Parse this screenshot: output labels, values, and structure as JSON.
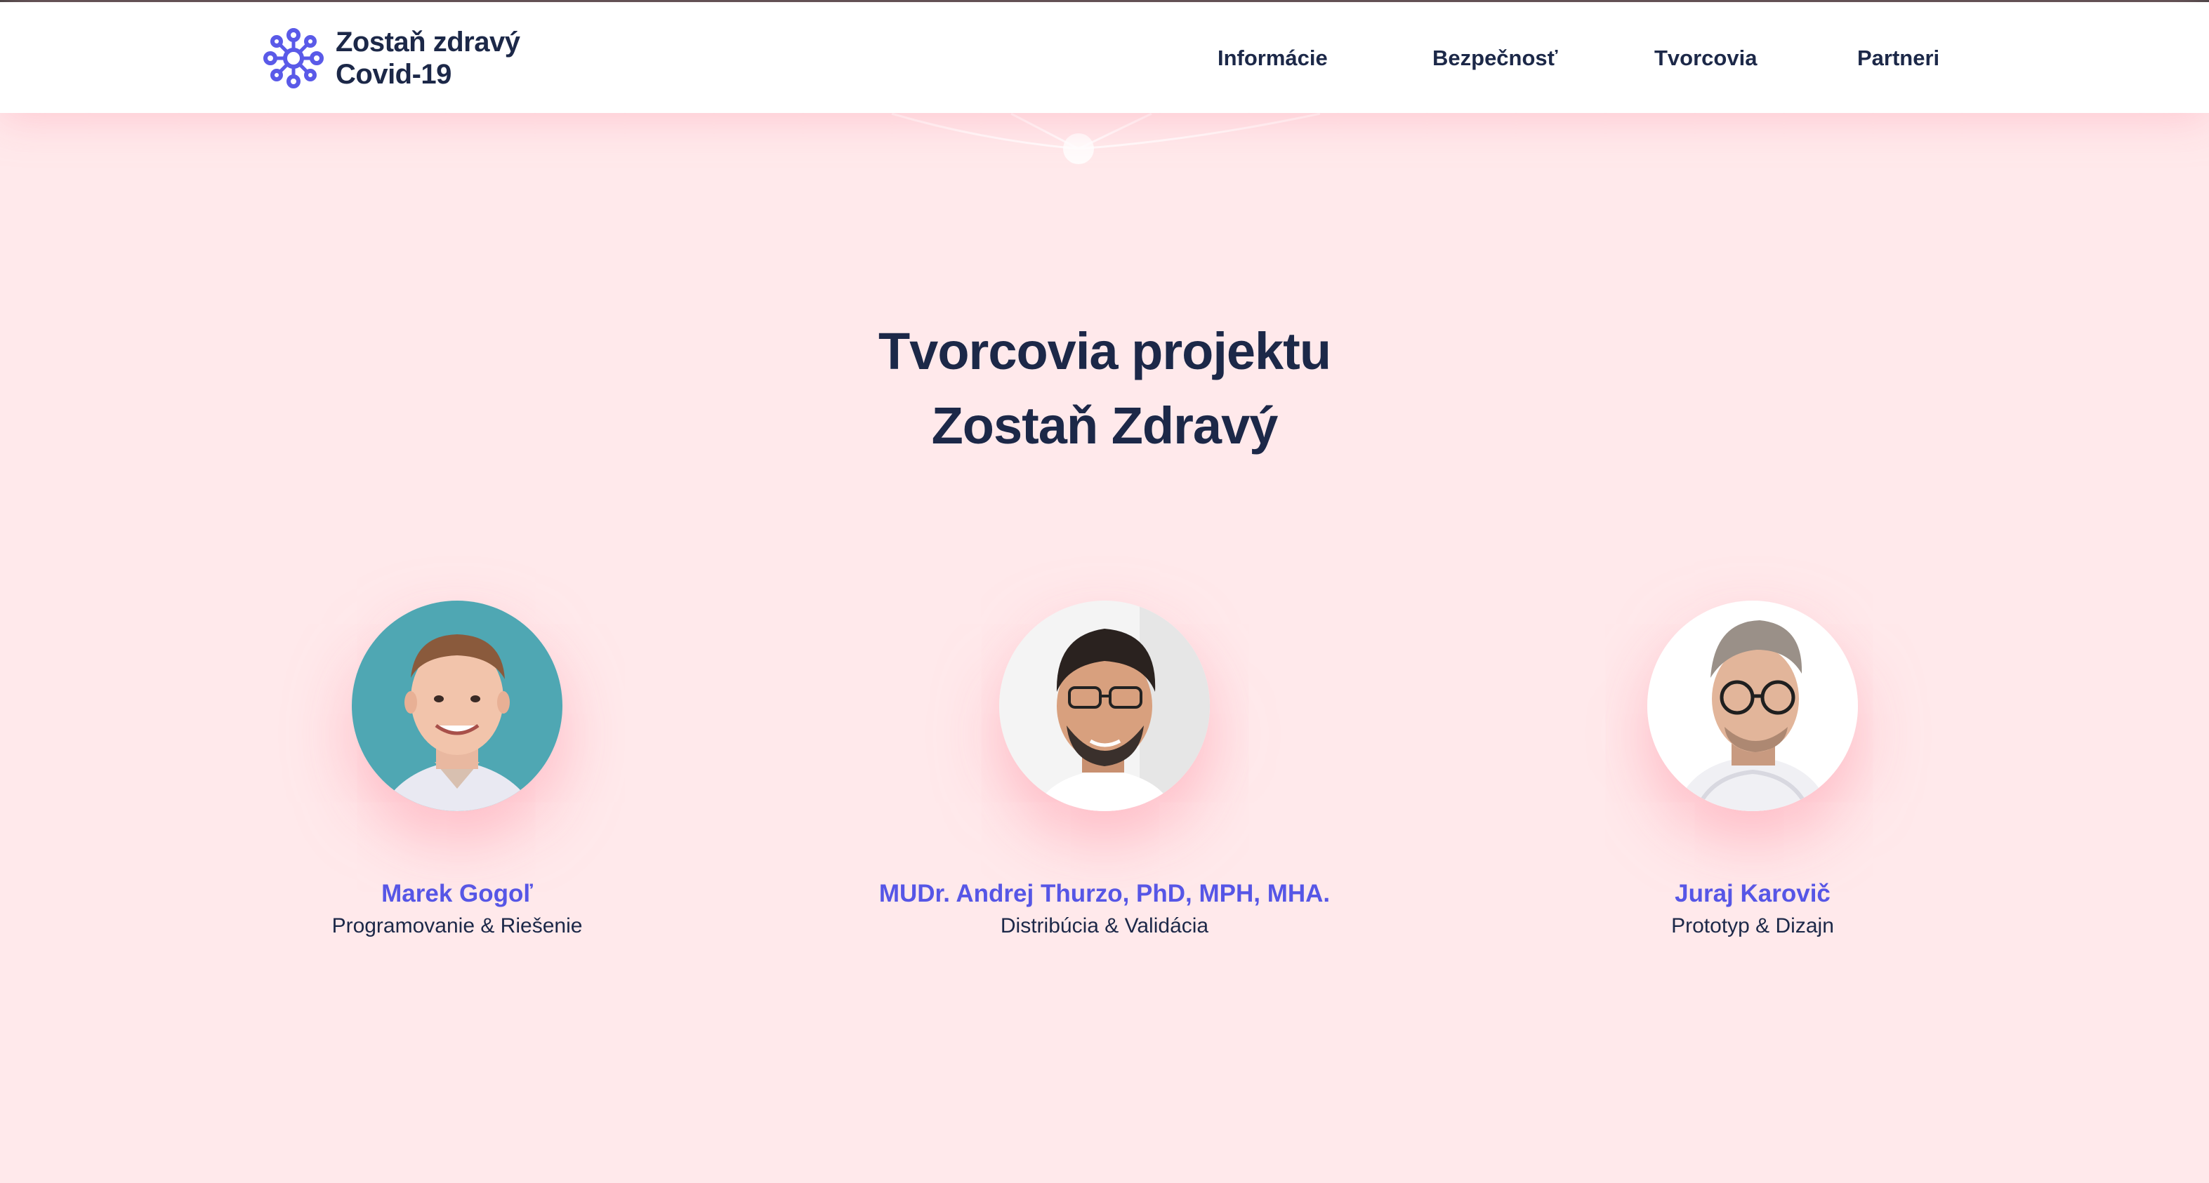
{
  "header": {
    "logo_line1": "Zostaň zdravý",
    "logo_line2": "Covid-19",
    "nav": [
      {
        "label": "Informácie"
      },
      {
        "label": "Bezpečnosť"
      },
      {
        "label": "Tvorcovia"
      },
      {
        "label": "Partneri"
      }
    ]
  },
  "section": {
    "title_line1": "Tvorcovia projektu",
    "title_line2": "Zostaň Zdravý"
  },
  "team": [
    {
      "name": "Marek Gogoľ",
      "role": "Programovanie & Riešenie"
    },
    {
      "name": "MUDr. Andrej Thurzo, PhD, MPH, MHA.",
      "role": "Distribúcia & Validácia"
    },
    {
      "name": "Juraj Karovič",
      "role": "Prototyp & Dizajn"
    }
  ],
  "colors": {
    "navy": "#1c2848",
    "accent": "#5656e6",
    "background": "#ffe9eb"
  }
}
